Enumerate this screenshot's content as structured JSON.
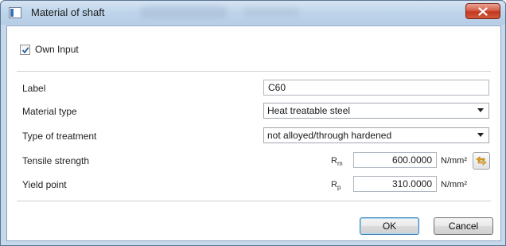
{
  "window": {
    "title": "Material of shaft"
  },
  "own_input": {
    "label": "Own Input",
    "checked": true
  },
  "form": {
    "label": {
      "caption": "Label",
      "value": "C60"
    },
    "material_type": {
      "caption": "Material type",
      "selected": "Heat treatable steel"
    },
    "treatment": {
      "caption": "Type of treatment",
      "selected": "not alloyed/through hardened"
    },
    "tensile": {
      "caption": "Tensile strength",
      "symbol": "R",
      "subscript": "m",
      "value": "600.0000",
      "unit": "N/mm²"
    },
    "yield": {
      "caption": "Yield point",
      "symbol": "R",
      "subscript": "p",
      "value": "310.0000",
      "unit": "N/mm²"
    }
  },
  "buttons": {
    "ok": "OK",
    "cancel": "Cancel"
  },
  "icons": {
    "app": "window-app-icon",
    "close": "close-icon",
    "swap": "swap-arrows-icon",
    "dropdown": "chevron-down-icon"
  }
}
